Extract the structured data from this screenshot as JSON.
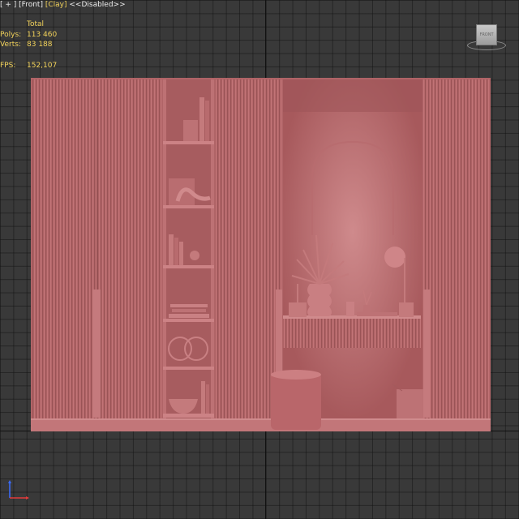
{
  "viewport": {
    "menu_label": "[ + ]",
    "view_label": "[Front]",
    "shading_label": "[Clay]",
    "mode_label": "<<Disabled>>"
  },
  "stats": {
    "header": "Total",
    "polys_label": "Polys:",
    "polys_value": "113 460",
    "verts_label": "Verts:",
    "verts_value": "83 188",
    "fps_label": "FPS:",
    "fps_value": "152,107"
  },
  "viewcube": {
    "face_label": "FRONT"
  },
  "colors": {
    "background": "#393939",
    "clay": "#b86b6e",
    "stats_text": "#f2d25a"
  }
}
